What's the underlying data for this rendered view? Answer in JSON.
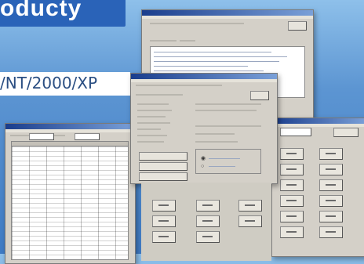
{
  "banner": {
    "title": "oducty"
  },
  "os": {
    "text": "/NT/2000/XP"
  },
  "windows": {
    "back": {
      "title": ""
    },
    "main": {
      "title": ""
    },
    "grid": {
      "title": ""
    },
    "keypad": {
      "title": ""
    }
  },
  "colors": {
    "background": "#5c95d2",
    "banner": "#2a63b8",
    "window": "#d4d0c8",
    "titlebar": "#1a3d8c"
  }
}
